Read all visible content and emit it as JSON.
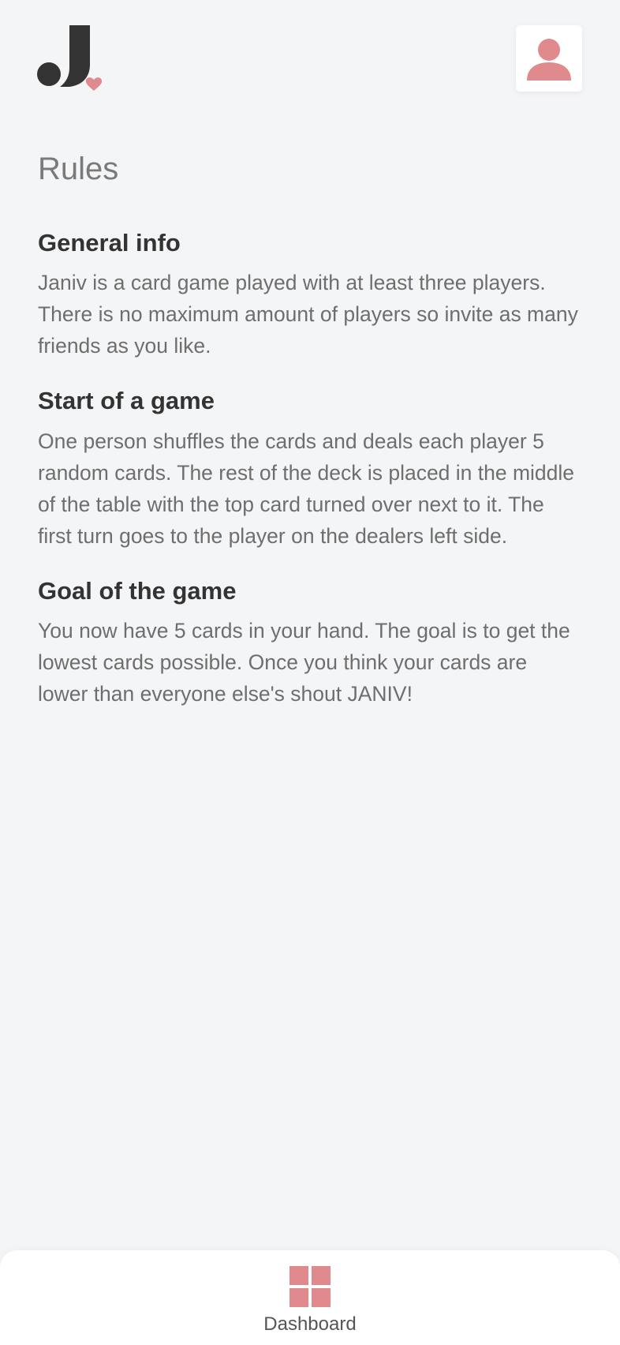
{
  "app": {
    "colors": {
      "accent": "#e08a8d",
      "dark": "#333333",
      "background": "#f4f5f7"
    },
    "icons": {
      "logo": "janiv-logo-j-with-heart",
      "profile": "user-icon",
      "dashboard": "dashboard-grid-icon"
    }
  },
  "page": {
    "title": "Rules"
  },
  "sections": [
    {
      "heading": "General info",
      "body": "Janiv is a card game played with at least three players. There is no maximum amount of players so invite as many friends as you like."
    },
    {
      "heading": "Start of a game",
      "body": "One person shuffles the cards and deals each player 5 random cards. The rest of the deck is placed in the middle of the table with the top card turned over next to it. The first turn goes to the player on the dealers left side."
    },
    {
      "heading": "Goal of the game",
      "body": "You now have 5 cards in your hand. The goal is to get the lowest cards possible. Once you think your cards are lower than everyone else's shout JANIV!"
    }
  ],
  "bottom_nav": {
    "items": [
      {
        "label": "Dashboard"
      }
    ]
  }
}
